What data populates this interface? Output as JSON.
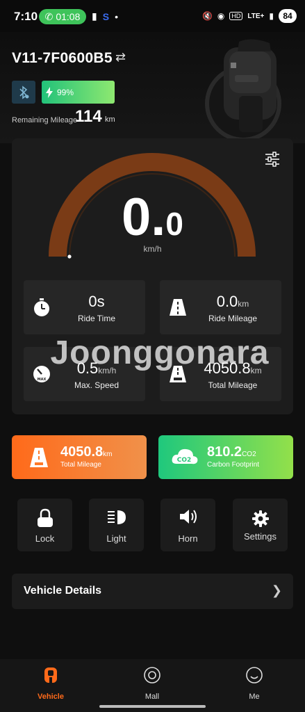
{
  "status_bar": {
    "time": "7:10",
    "call_timer": "01:08",
    "network": "LTE+",
    "battery": "84"
  },
  "vehicle": {
    "name": "V11-7F0600B5",
    "battery_percent": "99%",
    "battery_level": 0.99,
    "remaining_label": "Remaining Mileage",
    "remaining_value": "114",
    "remaining_unit": "km"
  },
  "gauge": {
    "speed_int": "0.",
    "speed_dec": "0",
    "unit": "km/h",
    "max_speed_fraction": 0.0
  },
  "stats": [
    {
      "icon": "stopwatch-icon",
      "value": "0s",
      "unit": "",
      "label": "Ride Time"
    },
    {
      "icon": "road-icon",
      "value": "0.0",
      "unit": "km",
      "label": "Ride Mileage"
    },
    {
      "icon": "speedometer-icon",
      "value": "0.5",
      "unit": "km/h",
      "label": "Max. Speed"
    },
    {
      "icon": "road-odometer-icon",
      "value": "4050.8",
      "unit": "km",
      "label": "Total Mileage"
    }
  ],
  "watermark": "Joonggonara",
  "summary": {
    "mileage": {
      "value": "4050.8",
      "unit": "km",
      "label": "Total Mileage"
    },
    "carbon": {
      "value": "810.2",
      "unit": "CO2",
      "label": "Carbon Footprint",
      "icon_text": "CO2"
    }
  },
  "controls": [
    {
      "icon": "lock-icon",
      "label": "Lock"
    },
    {
      "icon": "headlight-icon",
      "label": "Light"
    },
    {
      "icon": "horn-icon",
      "label": "Horn"
    },
    {
      "icon": "gear-icon",
      "label": "Settings"
    }
  ],
  "details": {
    "label": "Vehicle Details"
  },
  "nav": [
    {
      "icon": "vehicle-icon",
      "label": "Vehicle",
      "active": true
    },
    {
      "icon": "mall-icon",
      "label": "Mall",
      "active": false
    },
    {
      "icon": "me-icon",
      "label": "Me",
      "active": false
    }
  ],
  "colors": {
    "accent_orange": "#ff6a1a",
    "accent_green": "#22c27a",
    "gauge_arc": "#7a3b16",
    "card_bg": "#1c1c1c"
  }
}
